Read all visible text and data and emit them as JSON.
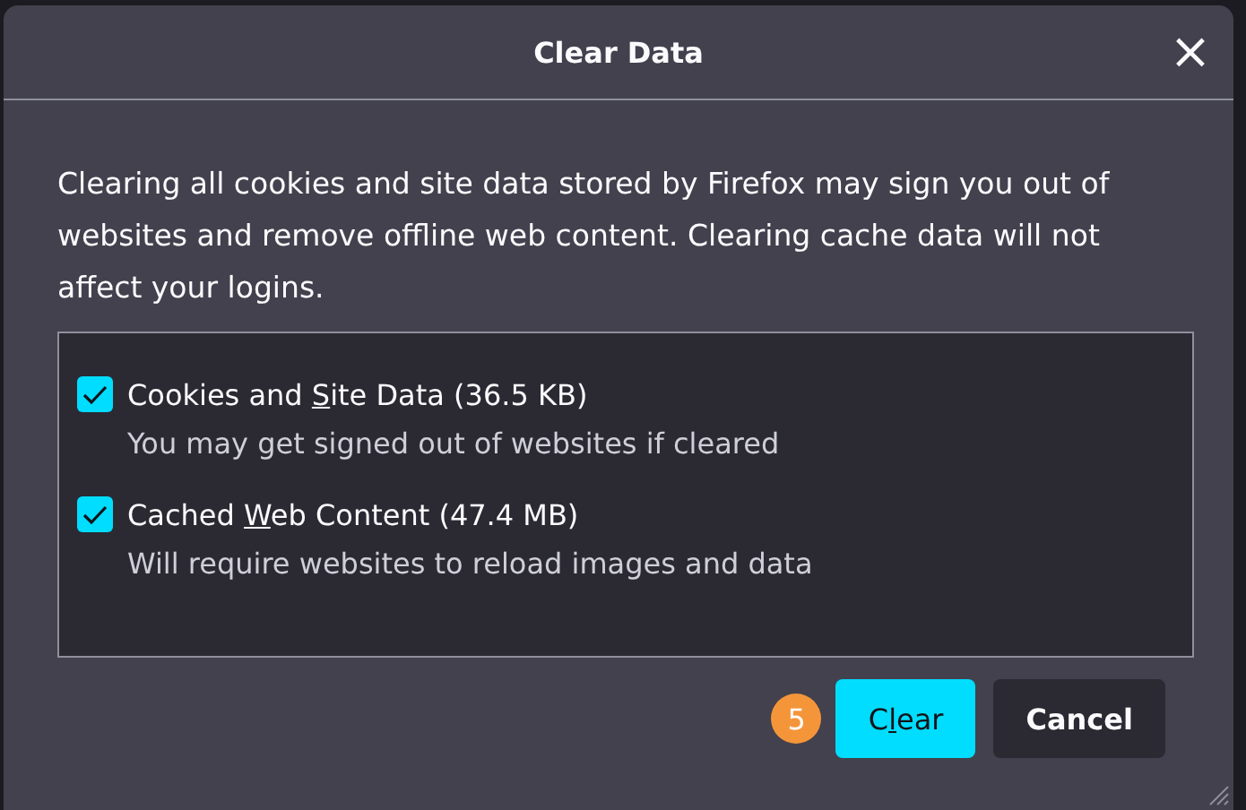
{
  "dialog": {
    "title": "Clear Data",
    "close_icon": "×"
  },
  "message": "Clearing all cookies and site data stored by Firefox may sign you out of websites and remove offline web content. Clearing cache data will not affect your logins.",
  "options": [
    {
      "label_before": "Cookies and ",
      "accesskey": "S",
      "label_after": "ite Data (36.5 KB)",
      "description": "You may get signed out of websites if cleared",
      "checked": true
    },
    {
      "label_before": "Cached ",
      "accesskey": "W",
      "label_after": "eb Content (47.4 MB)",
      "description": "Will require websites to reload images and data",
      "checked": true
    }
  ],
  "step_badge": "5",
  "buttons": [
    {
      "kind": "primary",
      "label_before": "C",
      "accesskey": "l",
      "label_after": "ear"
    },
    {
      "kind": "secondary",
      "label_before": "Cancel"
    }
  ]
}
